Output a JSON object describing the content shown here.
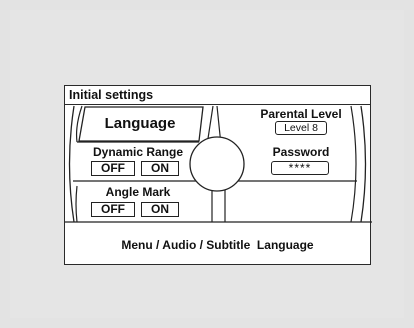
{
  "panel": {
    "title": "Initial settings"
  },
  "language": {
    "label": "Language"
  },
  "dynamic_range": {
    "label": "Dynamic Range",
    "off_label": "OFF",
    "on_label": "ON"
  },
  "angle_mark": {
    "label": "Angle Mark",
    "off_label": "OFF",
    "on_label": "ON"
  },
  "parental_level": {
    "label": "Parental Level",
    "value": "Level 8"
  },
  "password": {
    "label": "Password",
    "value": "****"
  },
  "footer": {
    "text": "Menu / Audio / Subtitle  Language"
  }
}
